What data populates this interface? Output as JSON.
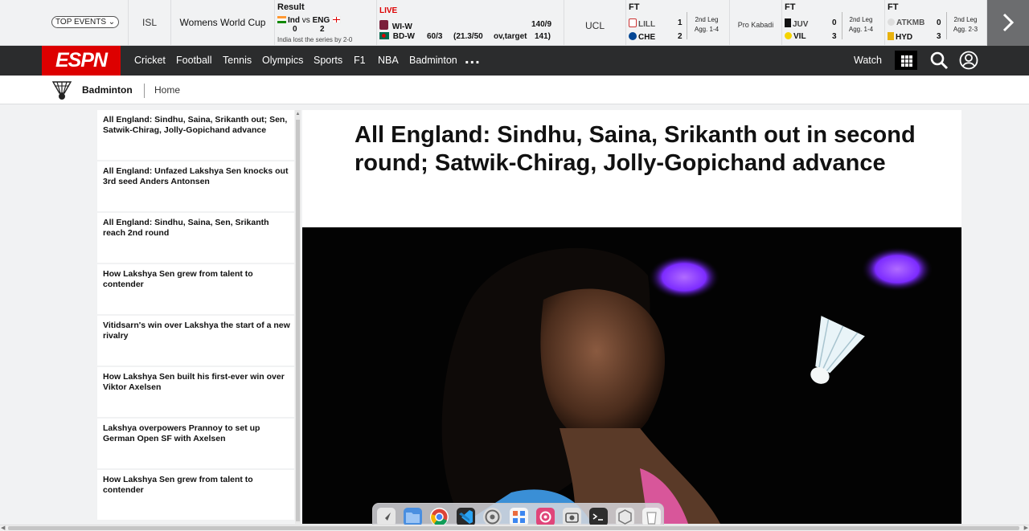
{
  "scoreboard": {
    "top_events_label": "TOP EVENTS",
    "isl_label": "ISL",
    "wwc_label": "Womens World Cup",
    "result": {
      "status": "Result",
      "team1": "Ind",
      "vs": "vs",
      "team2": "ENG",
      "score1": "0",
      "score2": "2",
      "note": "India lost the series by 2-0"
    },
    "live": {
      "status": "LIVE",
      "team1": "WI-W",
      "team1_score": "140/9",
      "team2": "BD-W",
      "team2_score": "60/3",
      "team2_overs": "(21.3/50",
      "team2_target_label": "ov,target",
      "team2_target": "141)"
    },
    "ucl_label": "UCL",
    "match1": {
      "status": "FT",
      "team1": "LILL",
      "score1": "1",
      "team2": "CHE",
      "score2": "2",
      "leg": "2nd  Leg",
      "agg": "Agg. 1-4"
    },
    "kabaddi_label": "Pro Kabadi",
    "match2": {
      "status": "FT",
      "team1": "JUV",
      "score1": "0",
      "team2": "VIL",
      "score2": "3",
      "leg": "2nd  Leg",
      "agg": "Agg. 1-4"
    },
    "match3": {
      "status": "FT",
      "team1": "ATKMB",
      "score1": "0",
      "team2": "HYD",
      "score2": "3",
      "leg": "2nd  Leg",
      "agg": "Agg. 2-3"
    },
    "next_icon": "chevron-right-icon"
  },
  "nav": {
    "logo": "ESPN",
    "items": [
      "Cricket",
      "Football",
      "Tennis",
      "Olympics",
      "Sports",
      "F1",
      "NBA",
      "Badminton"
    ],
    "more": "...",
    "watch": "Watch",
    "icons": [
      "grid-icon",
      "search-icon",
      "user-icon"
    ],
    "accent": "#d00000",
    "bar_color": "#2b2c2d"
  },
  "subnav": {
    "sport": "Badminton",
    "home": "Home",
    "icon": "shuttlecock-icon"
  },
  "sidebar": {
    "items": [
      "All England: Sindhu, Saina, Srikanth out; Sen, Satwik-Chirag, Jolly-Gopichand advance",
      "All England: Unfazed Lakshya Sen knocks out 3rd seed Anders Antonsen",
      "All England: Sindhu, Saina, Sen, Srikanth reach 2nd round",
      "How Lakshya Sen grew from talent to contender",
      "Vitidsarn's win over Lakshya the start of a new rivalry",
      "How Lakshya Sen built his first-ever win over Viktor Axelsen",
      "Lakshya overpowers Prannoy to set up German Open SF with Axelsen",
      "How Lakshya Sen grew from talent to contender"
    ]
  },
  "article": {
    "headline": "All England: Sindhu, Saina, Srikanth out in second round; Satwik-Chirag, Jolly-Gopichand advance",
    "image_alt": "Badminton player looking at a shuttlecock"
  },
  "dock": {
    "apps": [
      "launchpad-icon",
      "files-icon",
      "chrome-icon",
      "vscode-icon",
      "settings-icon",
      "calculator-icon",
      "screen-recorder-icon",
      "screenshot-icon",
      "terminal-icon",
      "trash-settings-icon",
      "trash-icon"
    ]
  }
}
